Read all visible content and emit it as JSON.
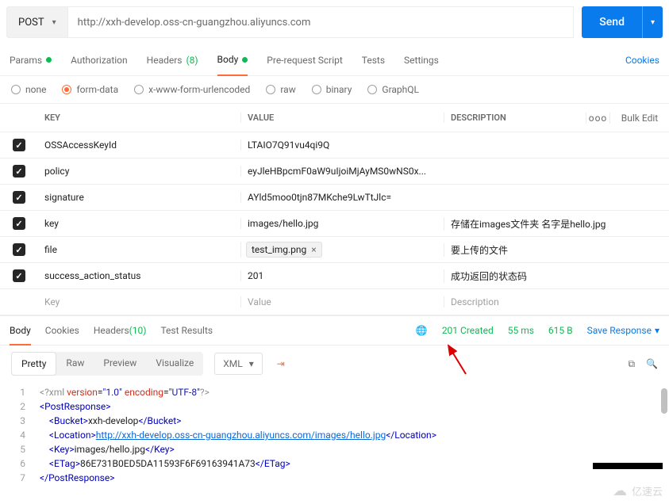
{
  "request": {
    "method": "POST",
    "url": "http://xxh-develop.oss-cn-guangzhou.aliyuncs.com",
    "send_label": "Send"
  },
  "req_tabs": {
    "params": "Params",
    "auth": "Authorization",
    "headers": "Headers",
    "headers_count": "(8)",
    "body": "Body",
    "prereq": "Pre-request Script",
    "tests": "Tests",
    "settings": "Settings",
    "cookies": "Cookies"
  },
  "body_types": {
    "none": "none",
    "formdata": "form-data",
    "xform": "x-www-form-urlencoded",
    "raw": "raw",
    "binary": "binary",
    "graphql": "GraphQL"
  },
  "kv": {
    "head_key": "KEY",
    "head_value": "VALUE",
    "head_desc": "DESCRIPTION",
    "more": "ooo",
    "bulk": "Bulk Edit",
    "rows": [
      {
        "k": "OSSAccessKeyId",
        "v": "LTAIO7Q91vu4qi9Q",
        "d": ""
      },
      {
        "k": "policy",
        "v": "eyJleHBpcmF0aW9uIjoiMjAyMS0wNS0x...",
        "d": ""
      },
      {
        "k": "signature",
        "v": "AYld5moo0tjn87MKche9LwTtJlc=",
        "d": ""
      },
      {
        "k": "key",
        "v": "images/hello.jpg",
        "d": "存储在images文件夹  名字是hello.jpg"
      },
      {
        "k": "file",
        "v": "test_img.png",
        "d": "要上传的文件",
        "file": true
      },
      {
        "k": "success_action_status",
        "v": "201",
        "d": "成功返回的状态码"
      }
    ],
    "ph_key": "Key",
    "ph_value": "Value",
    "ph_desc": "Description"
  },
  "resp_tabs": {
    "body": "Body",
    "cookies": "Cookies",
    "headers": "Headers",
    "headers_count": "(10)",
    "tests": "Test Results",
    "status": "201 Created",
    "time": "55 ms",
    "size": "615 B",
    "save": "Save Response"
  },
  "view": {
    "pretty": "Pretty",
    "raw": "Raw",
    "preview": "Preview",
    "visualize": "Visualize",
    "format": "XML"
  },
  "xml": {
    "l1_a": "<?xml",
    "l1_b": "version",
    "l1_c": "\"1.0\"",
    "l1_d": "encoding",
    "l1_e": "\"UTF-8\"",
    "l1_f": "?>",
    "l2_a": "<",
    "l2_b": "PostResponse",
    "l2_c": ">",
    "l3_a": "<",
    "l3_b": "Bucket",
    "l3_c": ">",
    "l3_d": "xxh-develop",
    "l3_e": "</",
    "l3_f": ">",
    "l4_a": "<",
    "l4_b": "Location",
    "l4_c": ">",
    "l4_d": "http://xxh-develop.oss-cn-guangzhou.aliyuncs.com/images/hello.jpg",
    "l4_e": "</",
    "l4_f": ">",
    "l5_a": "<",
    "l5_b": "Key",
    "l5_c": ">",
    "l5_d": "images/hello.jpg",
    "l5_e": "</",
    "l5_f": ">",
    "l6_a": "<",
    "l6_b": "ETag",
    "l6_c": ">",
    "l6_d": "86E731B0ED5DA11593F6F69163941A73",
    "l6_e": "</",
    "l6_f": ">",
    "l7_a": "</",
    "l7_b": "PostResponse",
    "l7_c": ">"
  },
  "watermark": "亿速云"
}
